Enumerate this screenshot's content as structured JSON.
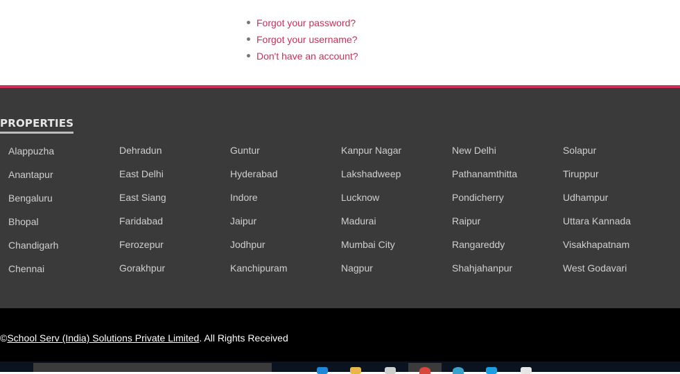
{
  "account_links": [
    {
      "label": "Forgot your password?"
    },
    {
      "label": "Forgot your username?"
    },
    {
      "label": "Don't have an account?"
    }
  ],
  "footer": {
    "heading": "PROPERTIES",
    "columns": [
      [
        "Alappuzha",
        "Anantapur",
        "Bengaluru",
        "Bhopal",
        "Chandigarh",
        "Chennai"
      ],
      [
        "Dehradun",
        "East Delhi",
        "East Siang",
        "Faridabad",
        "Ferozepur",
        "Gorakhpur"
      ],
      [
        "Guntur",
        "Hyderabad",
        "Indore",
        "Jaipur",
        "Jodhpur",
        "Kanchipuram"
      ],
      [
        "Kanpur Nagar",
        "Lakshadweep",
        "Lucknow",
        "Madurai",
        "Mumbai City",
        "Nagpur"
      ],
      [
        "New Delhi",
        "Pathanamthitta",
        "Pondicherry",
        "Raipur",
        "Rangareddy",
        "Shahjahanpur"
      ],
      [
        "Solapur",
        "Tiruppur",
        "Udhampur",
        "Uttara Kannada",
        "Visakhapatnam",
        "West Godavari"
      ]
    ]
  },
  "copyright": {
    "symbol": "©",
    "company": "School Serv (India) Solutions Private Limited",
    "suffix": ". All Rights Received"
  },
  "taskbar": {
    "icons": [
      "edge-icon",
      "file-explorer-icon",
      "store-icon",
      "chrome-icon",
      "globe-icon",
      "skype-icon",
      "notepad-icon"
    ]
  },
  "colors": {
    "accent": "#d12c56",
    "footer_bg": "#3a3a3a",
    "footer_link": "#cfcfcf",
    "bottom_bg": "#000000"
  }
}
